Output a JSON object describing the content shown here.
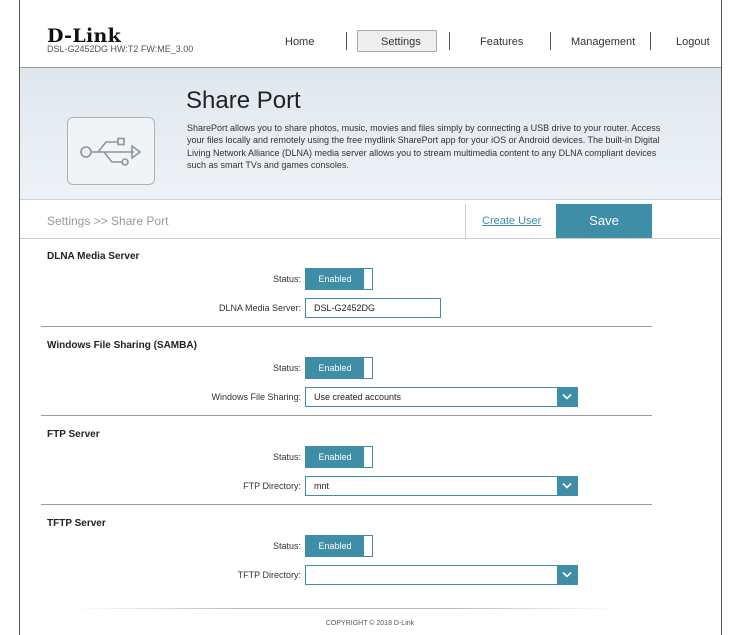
{
  "header": {
    "logo": "D-Link",
    "model": "DSL-G2452DG  HW:T2  FW:ME_3.00",
    "nav": {
      "home": "Home",
      "settings": "Settings",
      "features": "Features",
      "management": "Management",
      "logout": "Logout"
    }
  },
  "banner": {
    "title": "Share Port",
    "description": "SharePort allows you to share photos, music, movies and files simply by connecting a USB drive to your router. Access your files locally and remotely using the free mydlink SharePort app for your iOS or Android devices. The built-in Digital Living Network Alliance (DLNA) media server allows you to stream multimedia content to any DLNA compliant devices such as smart TVs and games consoles.",
    "icon": "usb-icon"
  },
  "toolbar": {
    "breadcrumb": "Settings >> Share Port",
    "create_user": "Create User",
    "save": "Save"
  },
  "dlna": {
    "title": "DLNA Media Server",
    "status_label": "Status:",
    "status_value": "Enabled",
    "server_label": "DLNA Media Server:",
    "server_value": "DSL-G2452DG"
  },
  "samba": {
    "title": "Windows File Sharing (SAMBA)",
    "status_label": "Status:",
    "status_value": "Enabled",
    "sharing_label": "Windows File Sharing:",
    "sharing_value": "Use created accounts"
  },
  "ftp": {
    "title": "FTP Server",
    "status_label": "Status:",
    "status_value": "Enabled",
    "dir_label": "FTP Directory:",
    "dir_value": "mnt"
  },
  "tftp": {
    "title": "TFTP Server",
    "status_label": "Status:",
    "status_value": "Enabled",
    "dir_label": "TFTP Directory:",
    "dir_value": ""
  },
  "footer": {
    "copyright": "COPYRIGHT © 2018 D-Link"
  },
  "colors": {
    "accent": "#3d8ea6",
    "banner_bg": "#e4ebf1"
  }
}
